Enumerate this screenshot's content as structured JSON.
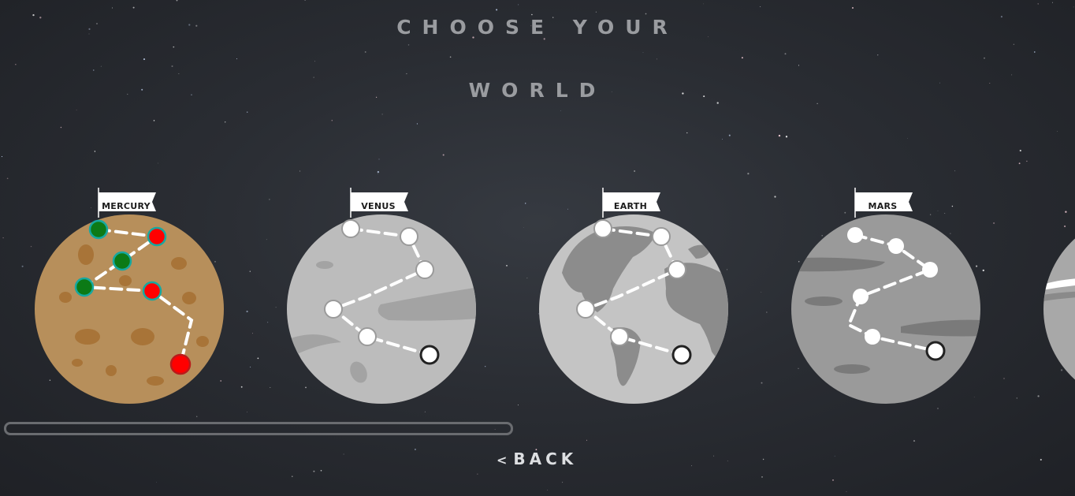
{
  "header": {
    "line1": "CHOOSE YOUR",
    "line2": "WORLD"
  },
  "planets": [
    {
      "name": "MERCURY",
      "color": "#b78f5b",
      "state": "active"
    },
    {
      "name": "VENUS",
      "color": "#bdbdbd",
      "state": "locked"
    },
    {
      "name": "EARTH",
      "color": "#c4c4c4",
      "state": "locked"
    },
    {
      "name": "MARS",
      "color": "#9a9a9a",
      "state": "locked"
    }
  ],
  "progress": {
    "fraction": 0
  },
  "footer": {
    "back_icon": "chevron-left-icon",
    "back_label": "BACK"
  },
  "colors": {
    "level_complete": "#0c7a16",
    "level_ring": "#16a8a0",
    "level_open": "#ff0000",
    "level_locked": "#ffffff"
  }
}
